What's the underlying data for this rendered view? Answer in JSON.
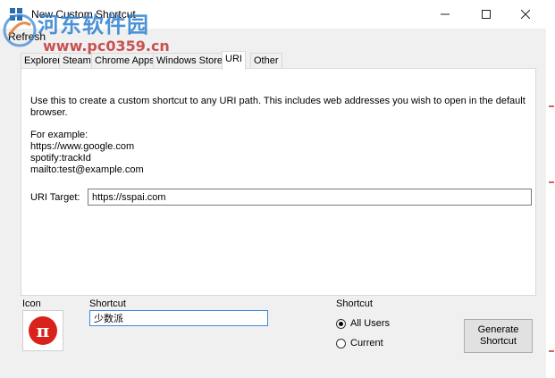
{
  "window": {
    "title": "New Custom Shortcut",
    "controls": {
      "minimize": "minimize",
      "maximize": "maximize",
      "close": "close"
    }
  },
  "watermark": {
    "text_cn": "河东软件园",
    "url": "www.pc0359.cn"
  },
  "menu": {
    "refresh_label": "Refresh"
  },
  "tabs": [
    {
      "label": "Explorer",
      "active": false
    },
    {
      "label": "Steam",
      "active": false
    },
    {
      "label": "Chrome Apps",
      "active": false
    },
    {
      "label": "Windows Store",
      "active": false
    },
    {
      "label": "URI",
      "active": true
    },
    {
      "label": "Other",
      "active": false
    }
  ],
  "uri_panel": {
    "description_line1": "Use this to create a custom shortcut to any URI path. This includes web addresses you wish to open in the default",
    "description_line2": "browser.",
    "example_heading": "For example:",
    "examples": [
      "https://www.google.com",
      "spotify:trackId",
      "mailto:test@example.com"
    ],
    "target_label": "URI Target:",
    "target_value": "https://sspai.com"
  },
  "bottom": {
    "icon_label": "Icon",
    "icon_glyph": "π",
    "icon_color": "#d9221c",
    "shortcut_name_label": "Shortcut",
    "shortcut_name_value": "少数派",
    "shortcut_scope_label": "Shortcut",
    "scope_options": [
      {
        "label": "All Users",
        "selected": true
      },
      {
        "label": "Current",
        "selected": false
      }
    ],
    "generate_line1": "Generate",
    "generate_line2": "Shortcut"
  }
}
